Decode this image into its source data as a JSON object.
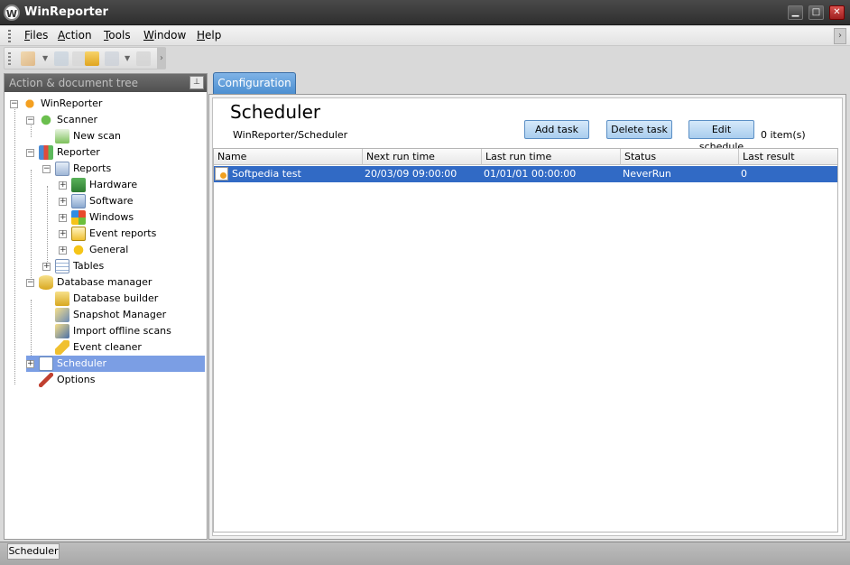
{
  "window": {
    "title": "WinReporter",
    "logo_letter": "W",
    "minimize": "▁",
    "maximize": "□",
    "close": "✕"
  },
  "menu": {
    "items": [
      "Files",
      "Action",
      "Tools",
      "Window",
      "Help"
    ],
    "overflow": "›"
  },
  "toolbar": {
    "icons": [
      "new-scan-icon",
      "save-icon",
      "open-folder-icon",
      "export-icon",
      "print-icon"
    ],
    "overflow": "›"
  },
  "left_panel": {
    "title": "Action & document tree",
    "pin": "📌",
    "tree": [
      {
        "label": "WinReporter",
        "icon": "winreporter-icon",
        "expand": "−"
      },
      {
        "label": "Scanner",
        "icon": "scanner-icon",
        "expand": "−"
      },
      {
        "label": "New scan",
        "icon": "new-scan-icon",
        "expand": ""
      },
      {
        "label": "Reporter",
        "icon": "reporter-icon",
        "expand": "−"
      },
      {
        "label": "Reports",
        "icon": "reports-icon",
        "expand": "−"
      },
      {
        "label": "Hardware",
        "icon": "hardware-icon",
        "expand": "+"
      },
      {
        "label": "Software",
        "icon": "software-icon",
        "expand": "+"
      },
      {
        "label": "Windows",
        "icon": "windows-icon",
        "expand": "+"
      },
      {
        "label": "Event reports",
        "icon": "event-reports-icon",
        "expand": "+"
      },
      {
        "label": "General",
        "icon": "general-icon",
        "expand": "+"
      },
      {
        "label": "Tables",
        "icon": "tables-icon",
        "expand": "+"
      },
      {
        "label": "Database manager",
        "icon": "database-icon",
        "expand": "−"
      },
      {
        "label": "Database builder",
        "icon": "database-builder-icon",
        "expand": ""
      },
      {
        "label": "Snapshot Manager",
        "icon": "snapshot-icon",
        "expand": ""
      },
      {
        "label": "Import offline scans",
        "icon": "import-icon",
        "expand": ""
      },
      {
        "label": "Event cleaner",
        "icon": "event-cleaner-icon",
        "expand": ""
      },
      {
        "label": "Scheduler",
        "icon": "scheduler-icon",
        "expand": "+"
      },
      {
        "label": "Options",
        "icon": "options-icon",
        "expand": ""
      }
    ],
    "selected": "Scheduler"
  },
  "main": {
    "tab_label": "Configuration",
    "page_title": "Scheduler",
    "breadcrumb": "WinReporter/Scheduler",
    "add_task": "Add task",
    "delete_task": "Delete task",
    "edit_schedule": "Edit schedule",
    "item_count": "0 item(s)",
    "columns": [
      "Name",
      "Next run time",
      "Last run time",
      "Status",
      "Last result"
    ],
    "rows": [
      [
        "Softpedia test",
        "20/03/09 09:00:00",
        "01/01/01 00:00:00",
        "NeverRun",
        "0"
      ]
    ]
  },
  "statusbar": {
    "tab": "Scheduler"
  },
  "colors": {
    "selection": "#316ac5",
    "tree_selection": "#7b9ee4",
    "tab_blue": "#4c8fd1"
  }
}
